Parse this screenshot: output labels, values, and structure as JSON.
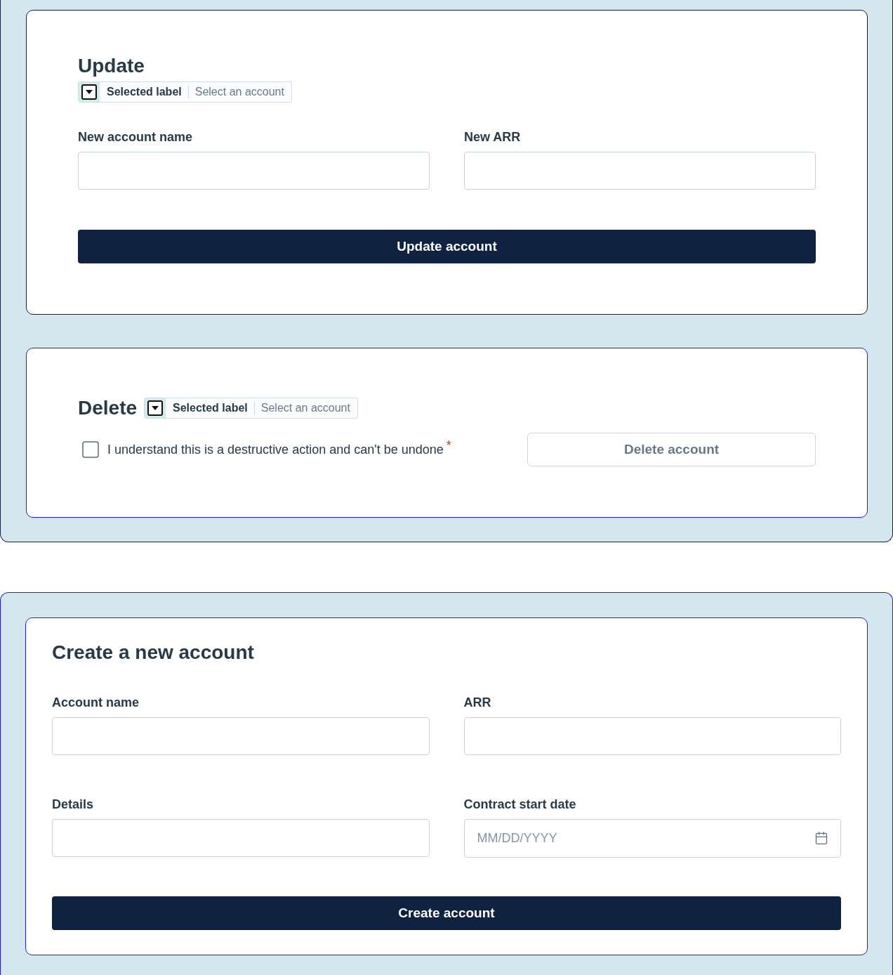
{
  "update_panel": {
    "title": "Update",
    "account_select": {
      "label": "Selected label",
      "placeholder": "Select an account"
    },
    "fields": [
      {
        "label": "New account name"
      },
      {
        "label": "New ARR"
      }
    ],
    "submit_button": "Update account"
  },
  "delete_panel": {
    "title": "Delete",
    "account_select": {
      "label": "Selected label",
      "placeholder": "Select an account"
    },
    "confirm_checkbox": {
      "label": "I understand this is a destructive action and can't be undone",
      "required_mark": "*",
      "checked": false
    },
    "delete_button": {
      "label": "Delete account",
      "disabled": true
    }
  },
  "create_panel": {
    "title": "Create a new account",
    "fields": [
      {
        "label": "Account name",
        "kind": "text"
      },
      {
        "label": "ARR",
        "kind": "text"
      },
      {
        "label": "Details",
        "kind": "text"
      },
      {
        "label": "Contract start date",
        "kind": "date",
        "placeholder": "MM/DD/YYYY"
      }
    ],
    "submit_button": "Create account"
  }
}
